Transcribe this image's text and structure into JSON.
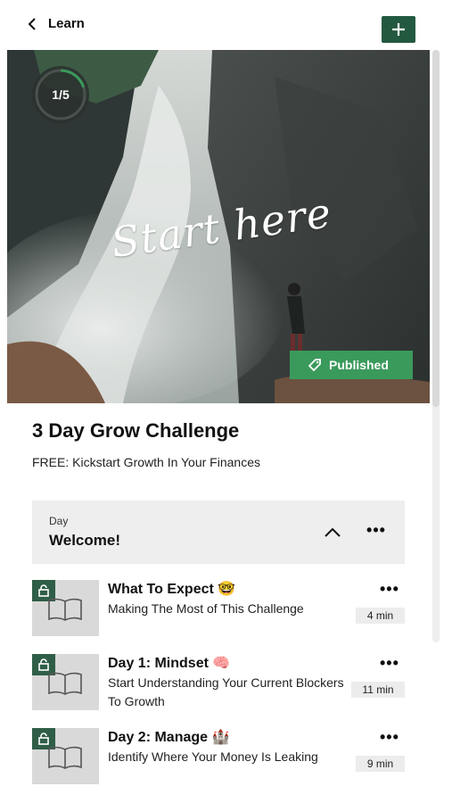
{
  "header": {
    "back_label": "Learn"
  },
  "hero": {
    "progress_text": "1/5",
    "progress_fraction": 0.2,
    "script_text": "Start here",
    "status_label": "Published"
  },
  "course": {
    "title": "3 Day Grow Challenge",
    "subtitle": "FREE: Kickstart Growth In Your Finances"
  },
  "section": {
    "kicker": "Day",
    "name": "Welcome!"
  },
  "lessons": [
    {
      "title": "What To Expect 🤓",
      "desc": "Making The Most of This Challenge",
      "duration": "4 min"
    },
    {
      "title": "Day 1: Mindset 🧠",
      "desc": "Start Understanding Your Current Blockers To Growth",
      "duration": "11 min"
    },
    {
      "title": "Day 2: Manage 🏰",
      "desc": "Identify Where Your Money Is Leaking",
      "duration": "9 min"
    }
  ],
  "colors": {
    "accent": "#23593f",
    "published": "#3a9a5b",
    "lock": "#2f5e47"
  },
  "icons": [
    "chevron-left-icon",
    "plus-icon",
    "tag-icon",
    "chevron-up-icon",
    "more-icon",
    "lock-icon",
    "book-icon"
  ]
}
